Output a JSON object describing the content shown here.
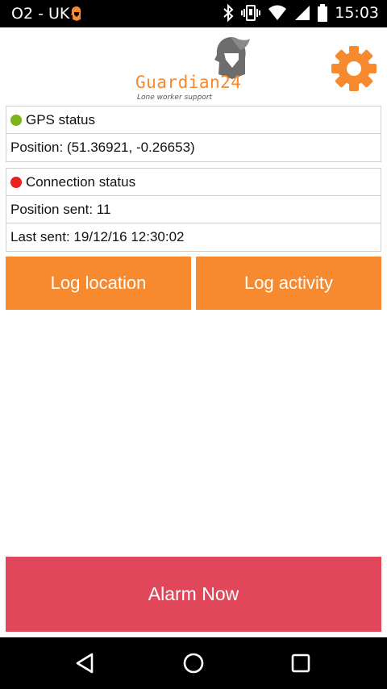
{
  "status_bar": {
    "carrier": "O2 - UK",
    "time": "15:03",
    "icons": [
      "guardian-notification-icon",
      "bluetooth-icon",
      "vibrate-icon",
      "wifi-icon",
      "signal-icon",
      "battery-icon"
    ]
  },
  "header": {
    "logo_text": "Guardian24",
    "logo_tagline": "Lone worker support",
    "settings_icon": "gear-icon"
  },
  "gps_card": {
    "title": "GPS status",
    "status_color": "#7cb518",
    "position_label": "Position: (51.36921, -0.26653)"
  },
  "connection_card": {
    "title": "Connection status",
    "status_color": "#e8211c",
    "positions_sent": "Position sent: 11",
    "last_sent": "Last sent: 19/12/16 12:30:02"
  },
  "actions": {
    "log_location": "Log location",
    "log_activity": "Log activity"
  },
  "alarm": {
    "label": "Alarm Now"
  },
  "colors": {
    "accent": "#f7892f",
    "alarm": "#e0475a"
  },
  "nav_bar": {
    "icons": [
      "back-icon",
      "home-icon",
      "recents-icon"
    ]
  }
}
